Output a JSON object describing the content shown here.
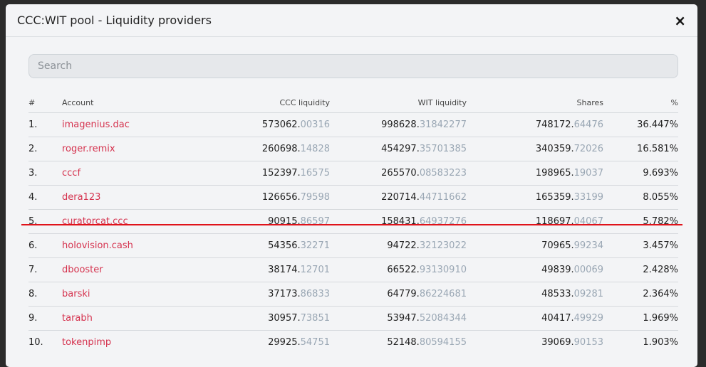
{
  "modal": {
    "title": "CCC:WIT pool - Liquidity providers",
    "close_icon": "×"
  },
  "search": {
    "placeholder": "Search",
    "value": ""
  },
  "table": {
    "headers": {
      "num": "#",
      "account": "Account",
      "ccc": "CCC liquidity",
      "wit": "WIT liquidity",
      "shares": "Shares",
      "pct": "%"
    },
    "rows": [
      {
        "num": "1.",
        "account": "imagenius.dac",
        "ccc_int": "573062.",
        "ccc_dec": "00316",
        "wit_int": "998628.",
        "wit_dec": "31842277",
        "sh_int": "748172.",
        "sh_dec": "64476",
        "pct": "36.447%"
      },
      {
        "num": "2.",
        "account": "roger.remix",
        "ccc_int": "260698.",
        "ccc_dec": "14828",
        "wit_int": "454297.",
        "wit_dec": "35701385",
        "sh_int": "340359.",
        "sh_dec": "72026",
        "pct": "16.581%"
      },
      {
        "num": "3.",
        "account": "cccf",
        "ccc_int": "152397.",
        "ccc_dec": "16575",
        "wit_int": "265570.",
        "wit_dec": "08583223",
        "sh_int": "198965.",
        "sh_dec": "19037",
        "pct": "9.693%"
      },
      {
        "num": "4.",
        "account": "dera123",
        "ccc_int": "126656.",
        "ccc_dec": "79598",
        "wit_int": "220714.",
        "wit_dec": "44711662",
        "sh_int": "165359.",
        "sh_dec": "33199",
        "pct": "8.055%"
      },
      {
        "num": "5.",
        "account": "curatorcat.ccc",
        "ccc_int": "90915.",
        "ccc_dec": "86597",
        "wit_int": "158431.",
        "wit_dec": "64937276",
        "sh_int": "118697.",
        "sh_dec": "04067",
        "pct": "5.782%"
      },
      {
        "num": "6.",
        "account": "holovision.cash",
        "ccc_int": "54356.",
        "ccc_dec": "32271",
        "wit_int": "94722.",
        "wit_dec": "32123022",
        "sh_int": "70965.",
        "sh_dec": "99234",
        "pct": "3.457%"
      },
      {
        "num": "7.",
        "account": "dbooster",
        "ccc_int": "38174.",
        "ccc_dec": "12701",
        "wit_int": "66522.",
        "wit_dec": "93130910",
        "sh_int": "49839.",
        "sh_dec": "00069",
        "pct": "2.428%"
      },
      {
        "num": "8.",
        "account": "barski",
        "ccc_int": "37173.",
        "ccc_dec": "86833",
        "wit_int": "64779.",
        "wit_dec": "86224681",
        "sh_int": "48533.",
        "sh_dec": "09281",
        "pct": "2.364%"
      },
      {
        "num": "9.",
        "account": "tarabh",
        "ccc_int": "30957.",
        "ccc_dec": "73851",
        "wit_int": "53947.",
        "wit_dec": "52084344",
        "sh_int": "40417.",
        "sh_dec": "49929",
        "pct": "1.969%"
      },
      {
        "num": "10.",
        "account": "tokenpimp",
        "ccc_int": "29925.",
        "ccc_dec": "54751",
        "wit_int": "52148.",
        "wit_dec": "80594155",
        "sh_int": "39069.",
        "sh_dec": "90153",
        "pct": "1.903%"
      }
    ]
  },
  "colors": {
    "account_link": "#d5324e",
    "decimal_text": "#9aa7b4",
    "highlight_line": "#e0121a",
    "modal_bg": "#f3f4f6"
  }
}
